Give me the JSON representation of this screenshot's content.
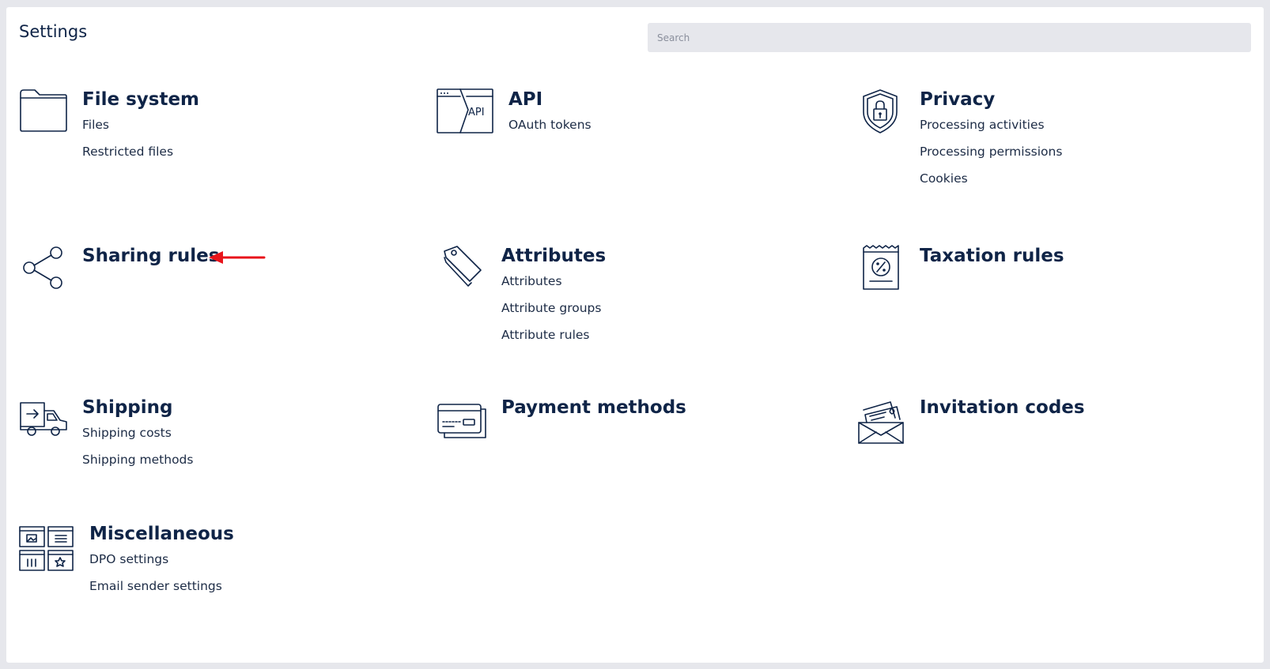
{
  "header": {
    "title": "Settings",
    "search_placeholder": "Search"
  },
  "tiles": {
    "file_system": {
      "title": "File system",
      "links": [
        "Files",
        "Restricted files"
      ],
      "icon": "folder-icon"
    },
    "api": {
      "title": "API",
      "icon_text": "API",
      "links": [
        "OAuth tokens"
      ],
      "icon": "api-window-icon"
    },
    "privacy": {
      "title": "Privacy",
      "links": [
        "Processing activities",
        "Processing permissions",
        "Cookies"
      ],
      "icon": "shield-lock-icon"
    },
    "sharing_rules": {
      "title": "Sharing rules",
      "links": [],
      "icon": "share-icon"
    },
    "attributes": {
      "title": "Attributes",
      "links": [
        "Attributes",
        "Attribute groups",
        "Attribute rules"
      ],
      "icon": "tags-icon"
    },
    "taxation_rules": {
      "title": "Taxation rules",
      "links": [],
      "icon": "receipt-percent-icon"
    },
    "shipping": {
      "title": "Shipping",
      "links": [
        "Shipping costs",
        "Shipping methods"
      ],
      "icon": "delivery-truck-icon"
    },
    "payment_methods": {
      "title": "Payment methods",
      "links": [],
      "icon": "credit-card-icon"
    },
    "invitation_codes": {
      "title": "Invitation codes",
      "links": [],
      "icon": "envelope-cards-icon"
    },
    "miscellaneous": {
      "title": "Miscellaneous",
      "links": [
        "DPO settings",
        "Email sender settings"
      ],
      "icon": "widgets-grid-icon"
    }
  },
  "annotation": {
    "arrow_color": "#e8141b",
    "icon": "red-arrow-left-icon"
  }
}
